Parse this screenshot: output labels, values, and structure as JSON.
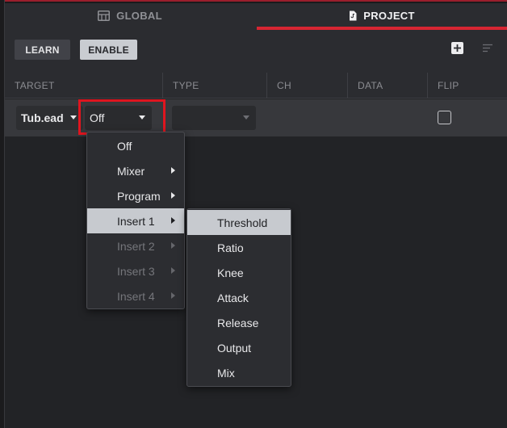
{
  "tabs": [
    {
      "label": "GLOBAL",
      "icon": "grid-icon",
      "active": false
    },
    {
      "label": "PROJECT",
      "icon": "document-icon",
      "active": true
    }
  ],
  "toolbar": {
    "learn_label": "LEARN",
    "enable_label": "ENABLE",
    "add_icon": "plus-square-icon",
    "sort_icon": "sort-lines-icon"
  },
  "columns": [
    "TARGET",
    "TYPE",
    "CH",
    "DATA",
    "FLIP"
  ],
  "row": {
    "target_value": "Tub.ead",
    "mode_value": "Off",
    "type_value": "",
    "flip_checked": false
  },
  "menu": {
    "items": [
      {
        "label": "Off",
        "has_submenu": false,
        "enabled": true,
        "selected": false
      },
      {
        "label": "Mixer",
        "has_submenu": true,
        "enabled": true,
        "selected": false
      },
      {
        "label": "Program",
        "has_submenu": true,
        "enabled": true,
        "selected": false
      },
      {
        "label": "Insert 1",
        "has_submenu": true,
        "enabled": true,
        "selected": true
      },
      {
        "label": "Insert 2",
        "has_submenu": true,
        "enabled": false,
        "selected": false
      },
      {
        "label": "Insert 3",
        "has_submenu": true,
        "enabled": false,
        "selected": false
      },
      {
        "label": "Insert 4",
        "has_submenu": true,
        "enabled": false,
        "selected": false
      }
    ]
  },
  "submenu": {
    "items": [
      {
        "label": "Threshold",
        "selected": true
      },
      {
        "label": "Ratio",
        "selected": false
      },
      {
        "label": "Knee",
        "selected": false
      },
      {
        "label": "Attack",
        "selected": false
      },
      {
        "label": "Release",
        "selected": false
      },
      {
        "label": "Output",
        "selected": false
      },
      {
        "label": "Mix",
        "selected": false
      }
    ]
  },
  "colors": {
    "accent_red": "#d62532",
    "highlight_red": "#e0151f",
    "selected_bg": "#c7cacf",
    "panel_bg": "#2b2c30"
  }
}
